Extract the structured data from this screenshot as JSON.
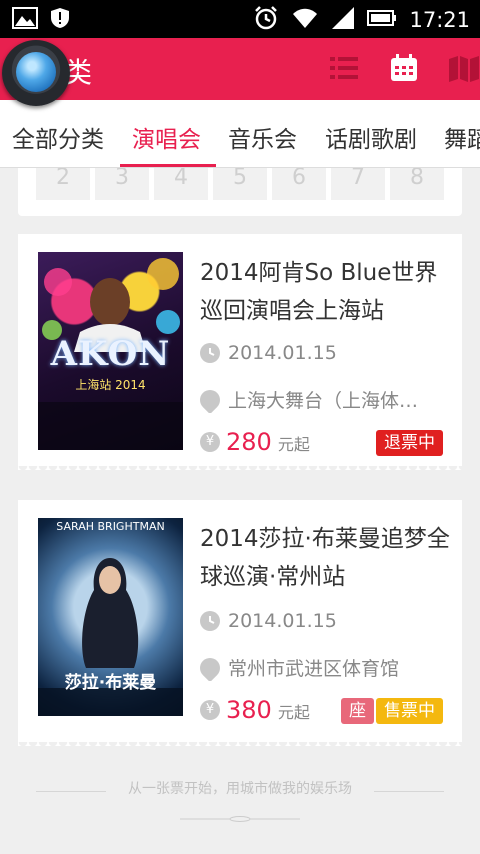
{
  "status_bar": {
    "time": "17:21"
  },
  "app": {
    "title": "类"
  },
  "tabs": [
    "全部分类",
    "演唱会",
    "音乐会",
    "话剧歌剧",
    "舞蹈"
  ],
  "calendar_strip": [
    "2",
    "3",
    "4",
    "5",
    "6",
    "7",
    "8"
  ],
  "events": [
    {
      "title": "2014阿肯So Blue世界巡回演唱会上海站",
      "date": "2014.01.15",
      "venue": "上海大舞台（上海体…",
      "price": "280",
      "price_unit": "元起",
      "status": "退票中",
      "status_color": "#e02020",
      "poster_caption": "AKON",
      "poster_sub": "上海站 2014"
    },
    {
      "title": "2014莎拉·布莱曼追梦全球巡演·常州站",
      "date": "2014.01.15",
      "venue": "常州市武进区体育馆",
      "price": "380",
      "price_unit": "元起",
      "seat_badge": "座",
      "status": "售票中",
      "status_color": "#f4b80f",
      "poster_caption": "SARAH BRIGHTMAN",
      "poster_sub": "莎拉·布莱曼"
    }
  ],
  "footer": {
    "slogan": "从一张票开始，用城市做我的娱乐场"
  },
  "colors": {
    "brand": "#e8204f"
  }
}
